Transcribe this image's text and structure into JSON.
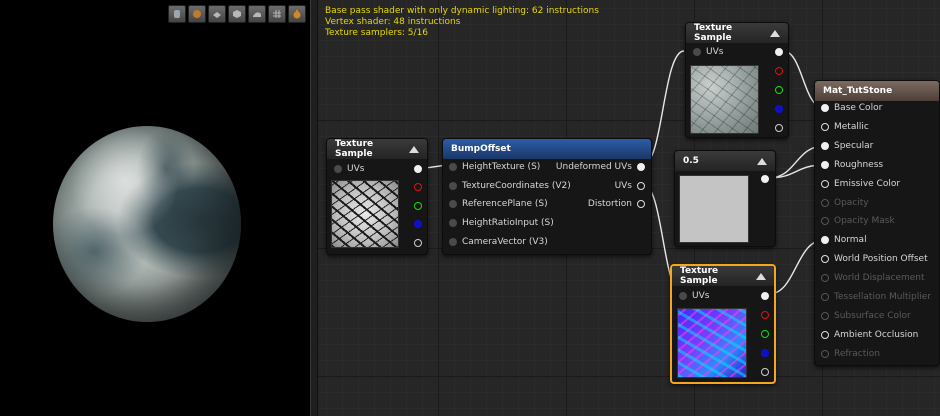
{
  "viewport": {
    "toolbar": [
      {
        "icon": "cylinder-icon",
        "color": "#9aa6b4"
      },
      {
        "icon": "sphere-icon",
        "color": "#c07a2a"
      },
      {
        "icon": "plane-icon",
        "color": "#b8b8b8"
      },
      {
        "icon": "cube-icon",
        "color": "#b8b8b8"
      },
      {
        "icon": "mesh-icon",
        "color": "#b8b8b8"
      },
      {
        "icon": "grid-icon",
        "color": "#b8b8b8"
      },
      {
        "icon": "realtime-icon",
        "color": "#d08a20"
      }
    ]
  },
  "stats": {
    "line1": "Base pass shader with only dynamic lighting: 62 instructions",
    "line2": "Vertex shader: 48 instructions",
    "line3": "Texture samplers: 5/16"
  },
  "nodes": {
    "tex_left": {
      "title": "Texture Sample",
      "uvs": "UVs"
    },
    "bump": {
      "title": "BumpOffset",
      "inputs": [
        "HeightTexture (S)",
        "TextureCoordinates (V2)",
        "ReferencePlane (S)",
        "HeightRatioInput (S)",
        "CameraVector (V3)"
      ],
      "outputs": [
        "Undeformed UVs",
        "UVs",
        "Distortion"
      ]
    },
    "tex_top": {
      "title": "Texture Sample",
      "uvs": "UVs"
    },
    "const": {
      "title": "0.5"
    },
    "tex_normal": {
      "title": "Texture Sample",
      "uvs": "UVs"
    },
    "result": {
      "title": "Mat_TutStone",
      "pins": [
        {
          "label": "Base Color",
          "active": true
        },
        {
          "label": "Metallic",
          "active": true
        },
        {
          "label": "Specular",
          "active": true
        },
        {
          "label": "Roughness",
          "active": true
        },
        {
          "label": "Emissive Color",
          "active": true
        },
        {
          "label": "Opacity",
          "active": false
        },
        {
          "label": "Opacity Mask",
          "active": false
        },
        {
          "label": "Normal",
          "active": true
        },
        {
          "label": "World Position Offset",
          "active": true
        },
        {
          "label": "World Displacement",
          "active": false
        },
        {
          "label": "Tessellation Multiplier",
          "active": false
        },
        {
          "label": "Subsurface Color",
          "active": false
        },
        {
          "label": "Ambient Occlusion",
          "active": true
        },
        {
          "label": "Refraction",
          "active": false
        }
      ]
    }
  },
  "colors": {
    "stats_text": "#e6d800",
    "selection": "#f4a61c",
    "bump_header": "#2c5da6",
    "result_header": "#7c6a60"
  }
}
